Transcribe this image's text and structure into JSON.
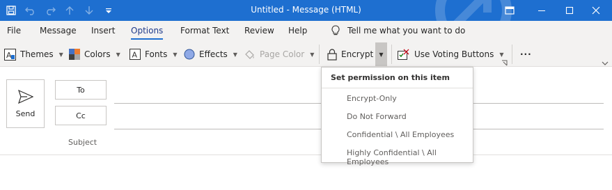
{
  "window": {
    "title": "Untitled  -  Message (HTML)"
  },
  "quick_access": [
    "save-icon",
    "undo-icon",
    "redo-icon",
    "up-arrow-icon",
    "down-arrow-icon",
    "customize-icon"
  ],
  "tabs": [
    {
      "label": "File"
    },
    {
      "label": "Message"
    },
    {
      "label": "Insert"
    },
    {
      "label": "Options",
      "active": true
    },
    {
      "label": "Format Text"
    },
    {
      "label": "Review"
    },
    {
      "label": "Help"
    }
  ],
  "tell_me": "Tell me what you want to do",
  "ribbon": {
    "themes": "Themes",
    "colors": "Colors",
    "fonts": "Fonts",
    "effects": "Effects",
    "page_color": "Page Color",
    "encrypt": "Encrypt",
    "voting": "Use Voting Buttons",
    "more": "···"
  },
  "compose": {
    "send": "Send",
    "to": "To",
    "cc": "Cc",
    "subject": "Subject"
  },
  "menu": {
    "header": "Set permission on this item",
    "items": [
      "Encrypt-Only",
      "Do Not Forward",
      "Confidential \\ All Employees",
      "Highly Confidential \\ All Employees"
    ]
  },
  "colors": {
    "titlebar": "#1e6fd0",
    "ribbon_bg": "#f3f2f1"
  }
}
